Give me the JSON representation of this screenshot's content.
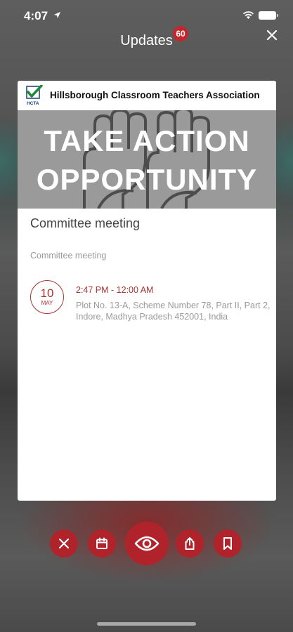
{
  "status_bar": {
    "time": "4:07"
  },
  "header": {
    "title": "Updates",
    "badge_count": "60"
  },
  "card": {
    "organization": "Hillsborough Classroom Teachers Association",
    "logo_text": "HCTA",
    "banner": {
      "line1": "TAKE ACTION",
      "line2": "OPPORTUNITY"
    },
    "event": {
      "title": "Committee meeting",
      "description": "Committee meeting",
      "date_day": "10",
      "date_month": "MAY",
      "time_range": "2:47 PM - 12:00 AM",
      "address": "Plot No. 13-A, Scheme Number 78, Part II, Part 2, Indore, Madhya Pradesh 452001, India"
    }
  },
  "actions": [
    {
      "icon": "close-icon"
    },
    {
      "icon": "calendar-icon"
    },
    {
      "icon": "eye-icon"
    },
    {
      "icon": "share-icon"
    },
    {
      "icon": "bookmark-icon"
    }
  ],
  "colors": {
    "accent": "#b1232a",
    "badge": "#c1272d",
    "date_red": "#aa3333"
  }
}
